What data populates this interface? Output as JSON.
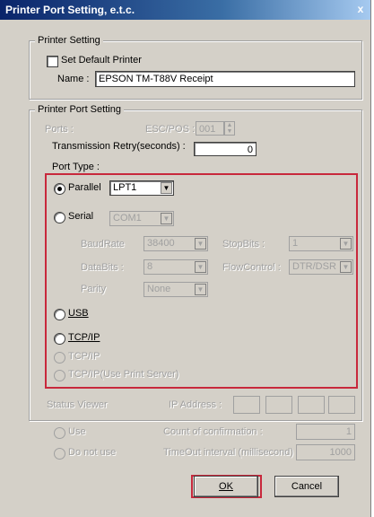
{
  "window": {
    "title": "Printer Port Setting, e.t.c.",
    "close_glyph": "x"
  },
  "printer_setting": {
    "legend": "Printer Setting",
    "default_label": "Set Default Printer",
    "name_label": "Name :",
    "name_value": "EPSON TM-T88V Receipt"
  },
  "port_setting": {
    "legend": "Printer Port Setting",
    "ports_label": "Ports :",
    "escpos_label": "ESC/POS :",
    "escpos_value": "001",
    "retry_label": "Transmission Retry(seconds) :",
    "retry_value": "0",
    "port_type_label": "Port Type :"
  },
  "port_type": {
    "parallel_label": "Parallel",
    "parallel_value": "LPT1",
    "serial_label": "Serial",
    "serial_value": "COM1",
    "baudrate_label": "BaudRate",
    "baudrate_value": "38400",
    "stopbits_label": "StopBits :",
    "stopbits_value": "1",
    "databits_label": "DataBits :",
    "databits_value": "8",
    "flowcontrol_label": "FlowControl :",
    "flowcontrol_value": "DTR/DSR",
    "parity_label": "Parity",
    "parity_value": "None",
    "usb_label": "USB",
    "tcpip_label": "TCP/IP",
    "tcpip2_label": "TCP/IP",
    "tcpip_ps_label": "TCP/IP(Use Print Server)"
  },
  "status": {
    "viewer_label": "Status Viewer",
    "ip_label": "IP Address :",
    "use_label": "Use",
    "notuse_label": "Do not use",
    "count_label": "Count of confirmation :",
    "count_value": "1",
    "timeout_label": "TimeOut interval (millisecond) :",
    "timeout_value": "1000"
  },
  "buttons": {
    "ok": "OK",
    "cancel": "Cancel"
  }
}
